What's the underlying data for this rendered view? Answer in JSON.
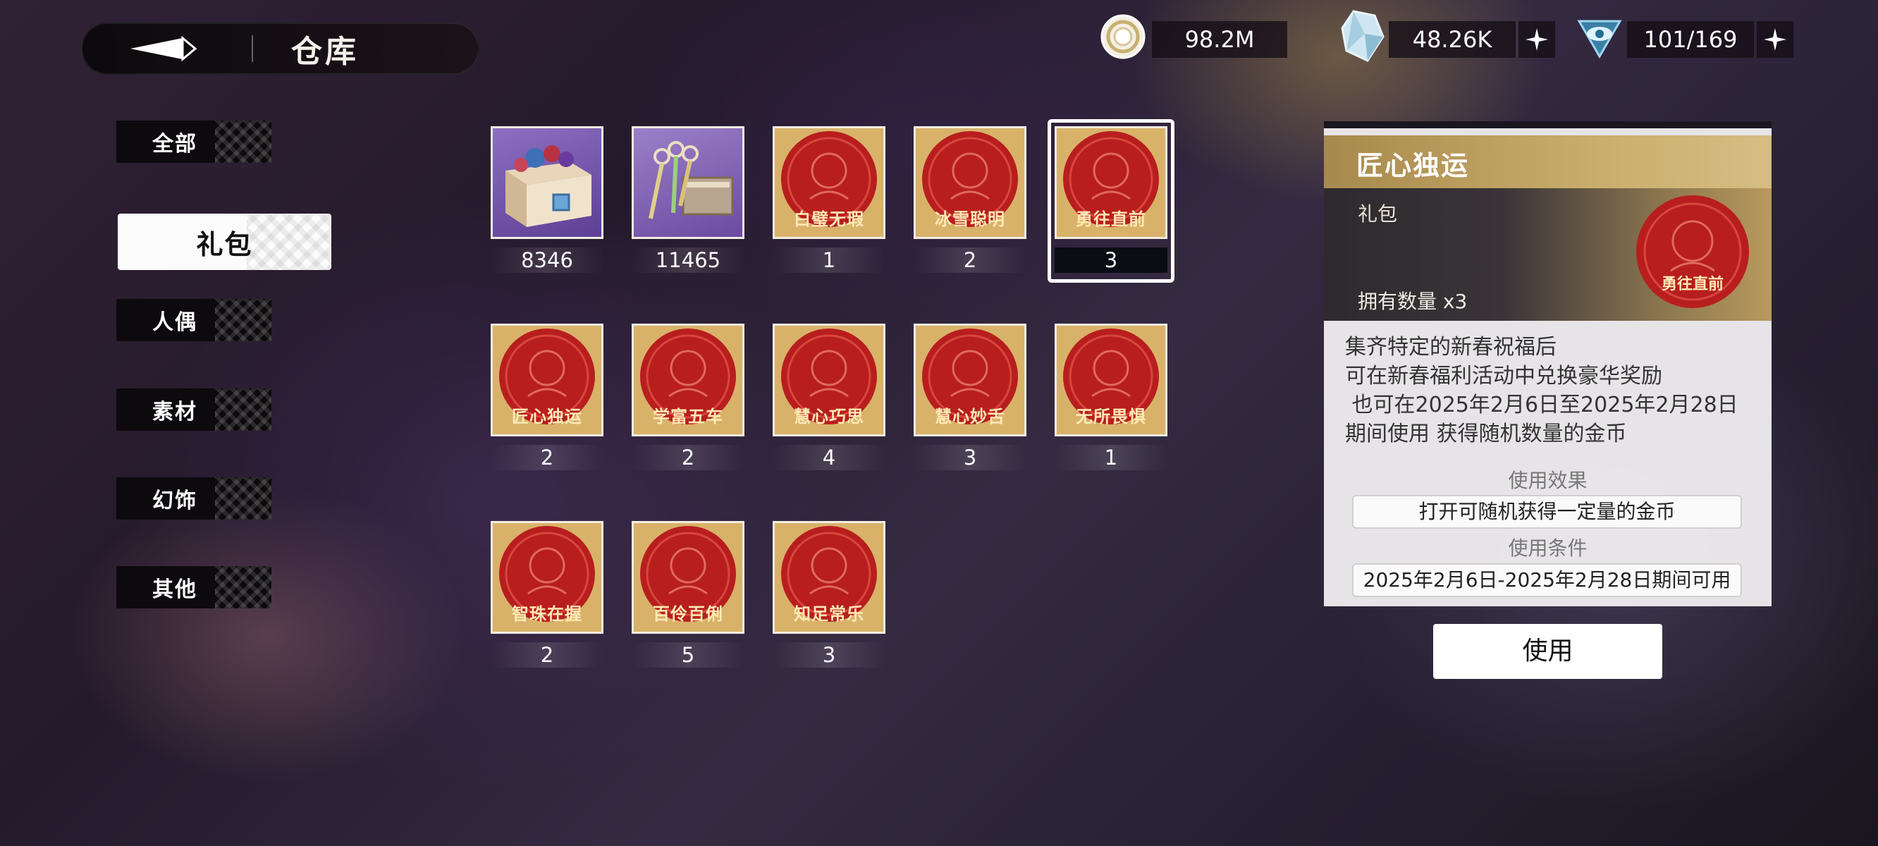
{
  "header": {
    "title": "仓库"
  },
  "currencies": [
    {
      "icon": "gold-coin-icon",
      "value": "98.2M"
    },
    {
      "icon": "crystal-icon",
      "value": "48.26K"
    },
    {
      "icon": "stamina-eye-icon",
      "value": "101/169"
    }
  ],
  "tabs": [
    {
      "label": "全部"
    },
    {
      "label": "礼包"
    },
    {
      "label": "人偶"
    },
    {
      "label": "素材"
    },
    {
      "label": "幻饰"
    },
    {
      "label": "其他"
    }
  ],
  "items": [
    {
      "label": "",
      "count": "8346",
      "kind": "chest"
    },
    {
      "label": "",
      "count": "11465",
      "kind": "keys"
    },
    {
      "label": "白璧无瑕",
      "count": "1",
      "kind": "stamp"
    },
    {
      "label": "冰雪聪明",
      "count": "2",
      "kind": "stamp"
    },
    {
      "label": "勇往直前",
      "count": "3",
      "kind": "stamp"
    },
    {
      "label": "匠心独运",
      "count": "2",
      "kind": "stamp"
    },
    {
      "label": "学富五车",
      "count": "2",
      "kind": "stamp"
    },
    {
      "label": "慧心巧思",
      "count": "4",
      "kind": "stamp"
    },
    {
      "label": "慧心妙舌",
      "count": "3",
      "kind": "stamp"
    },
    {
      "label": "无所畏惧",
      "count": "1",
      "kind": "stamp"
    },
    {
      "label": "智珠在握",
      "count": "2",
      "kind": "stamp"
    },
    {
      "label": "百伶百俐",
      "count": "5",
      "kind": "stamp"
    },
    {
      "label": "知足常乐",
      "count": "3",
      "kind": "stamp"
    }
  ],
  "detail": {
    "name": "匠心独运",
    "type": "礼包",
    "owned": "拥有数量 x3",
    "stamp_label": "勇往直前",
    "desc_lines": [
      "集齐特定的新春祝福后",
      "可在新春福利活动中兑换豪华奖励",
      " 也可在2025年2月6日至2025年2月28日",
      "期间使用 获得随机数量的金币"
    ],
    "effect_header": "使用效果",
    "effect": "打开可随机获得一定量的金币",
    "condition_header": "使用条件",
    "condition": "2025年2月6日-2025年2月28日期间可用",
    "use_button": "使用"
  },
  "colors": {
    "stamp_red": "#b81e1e",
    "stamp_gold": "#d9b26a",
    "header_gold": "#c9ad6d"
  }
}
